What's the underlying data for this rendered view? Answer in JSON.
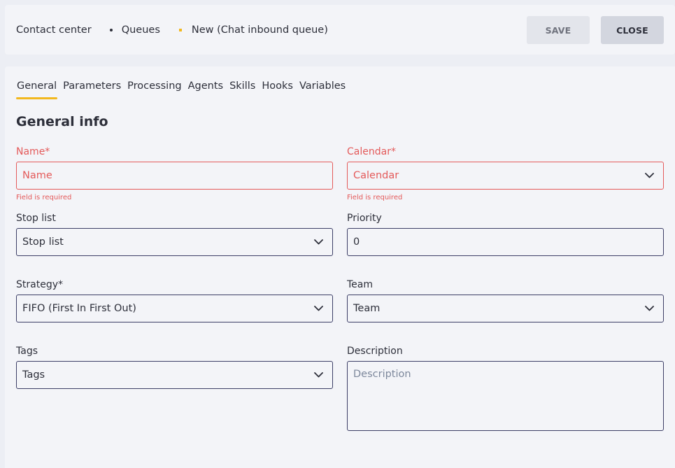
{
  "breadcrumb": {
    "items": [
      "Contact center",
      "Queues",
      "New (Chat inbound queue)"
    ]
  },
  "actions": {
    "save_label": "SAVE",
    "close_label": "CLOSE"
  },
  "tabs": [
    {
      "label": "General",
      "active": true
    },
    {
      "label": "Parameters"
    },
    {
      "label": "Processing"
    },
    {
      "label": "Agents"
    },
    {
      "label": "Skills"
    },
    {
      "label": "Hooks"
    },
    {
      "label": "Variables"
    }
  ],
  "section": {
    "title": "General info"
  },
  "form": {
    "name": {
      "label": "Name*",
      "placeholder": "Name",
      "error": "Field is required"
    },
    "calendar": {
      "label": "Calendar*",
      "placeholder": "Calendar",
      "error": "Field is required"
    },
    "stop_list": {
      "label": "Stop list",
      "value": "Stop list"
    },
    "priority": {
      "label": "Priority",
      "value": "0"
    },
    "strategy": {
      "label": "Strategy*",
      "value": "FIFO (First In First Out)"
    },
    "team": {
      "label": "Team",
      "value": "Team"
    },
    "tags": {
      "label": "Tags",
      "value": "Tags"
    },
    "description": {
      "label": "Description",
      "placeholder": "Description"
    }
  },
  "colors": {
    "accent": "#f2b81e",
    "error": "#e45a5a",
    "border": "#3c3e66"
  },
  "icons": {
    "dropdown": "chevron-down-icon",
    "separator": "dot-separator-icon"
  }
}
